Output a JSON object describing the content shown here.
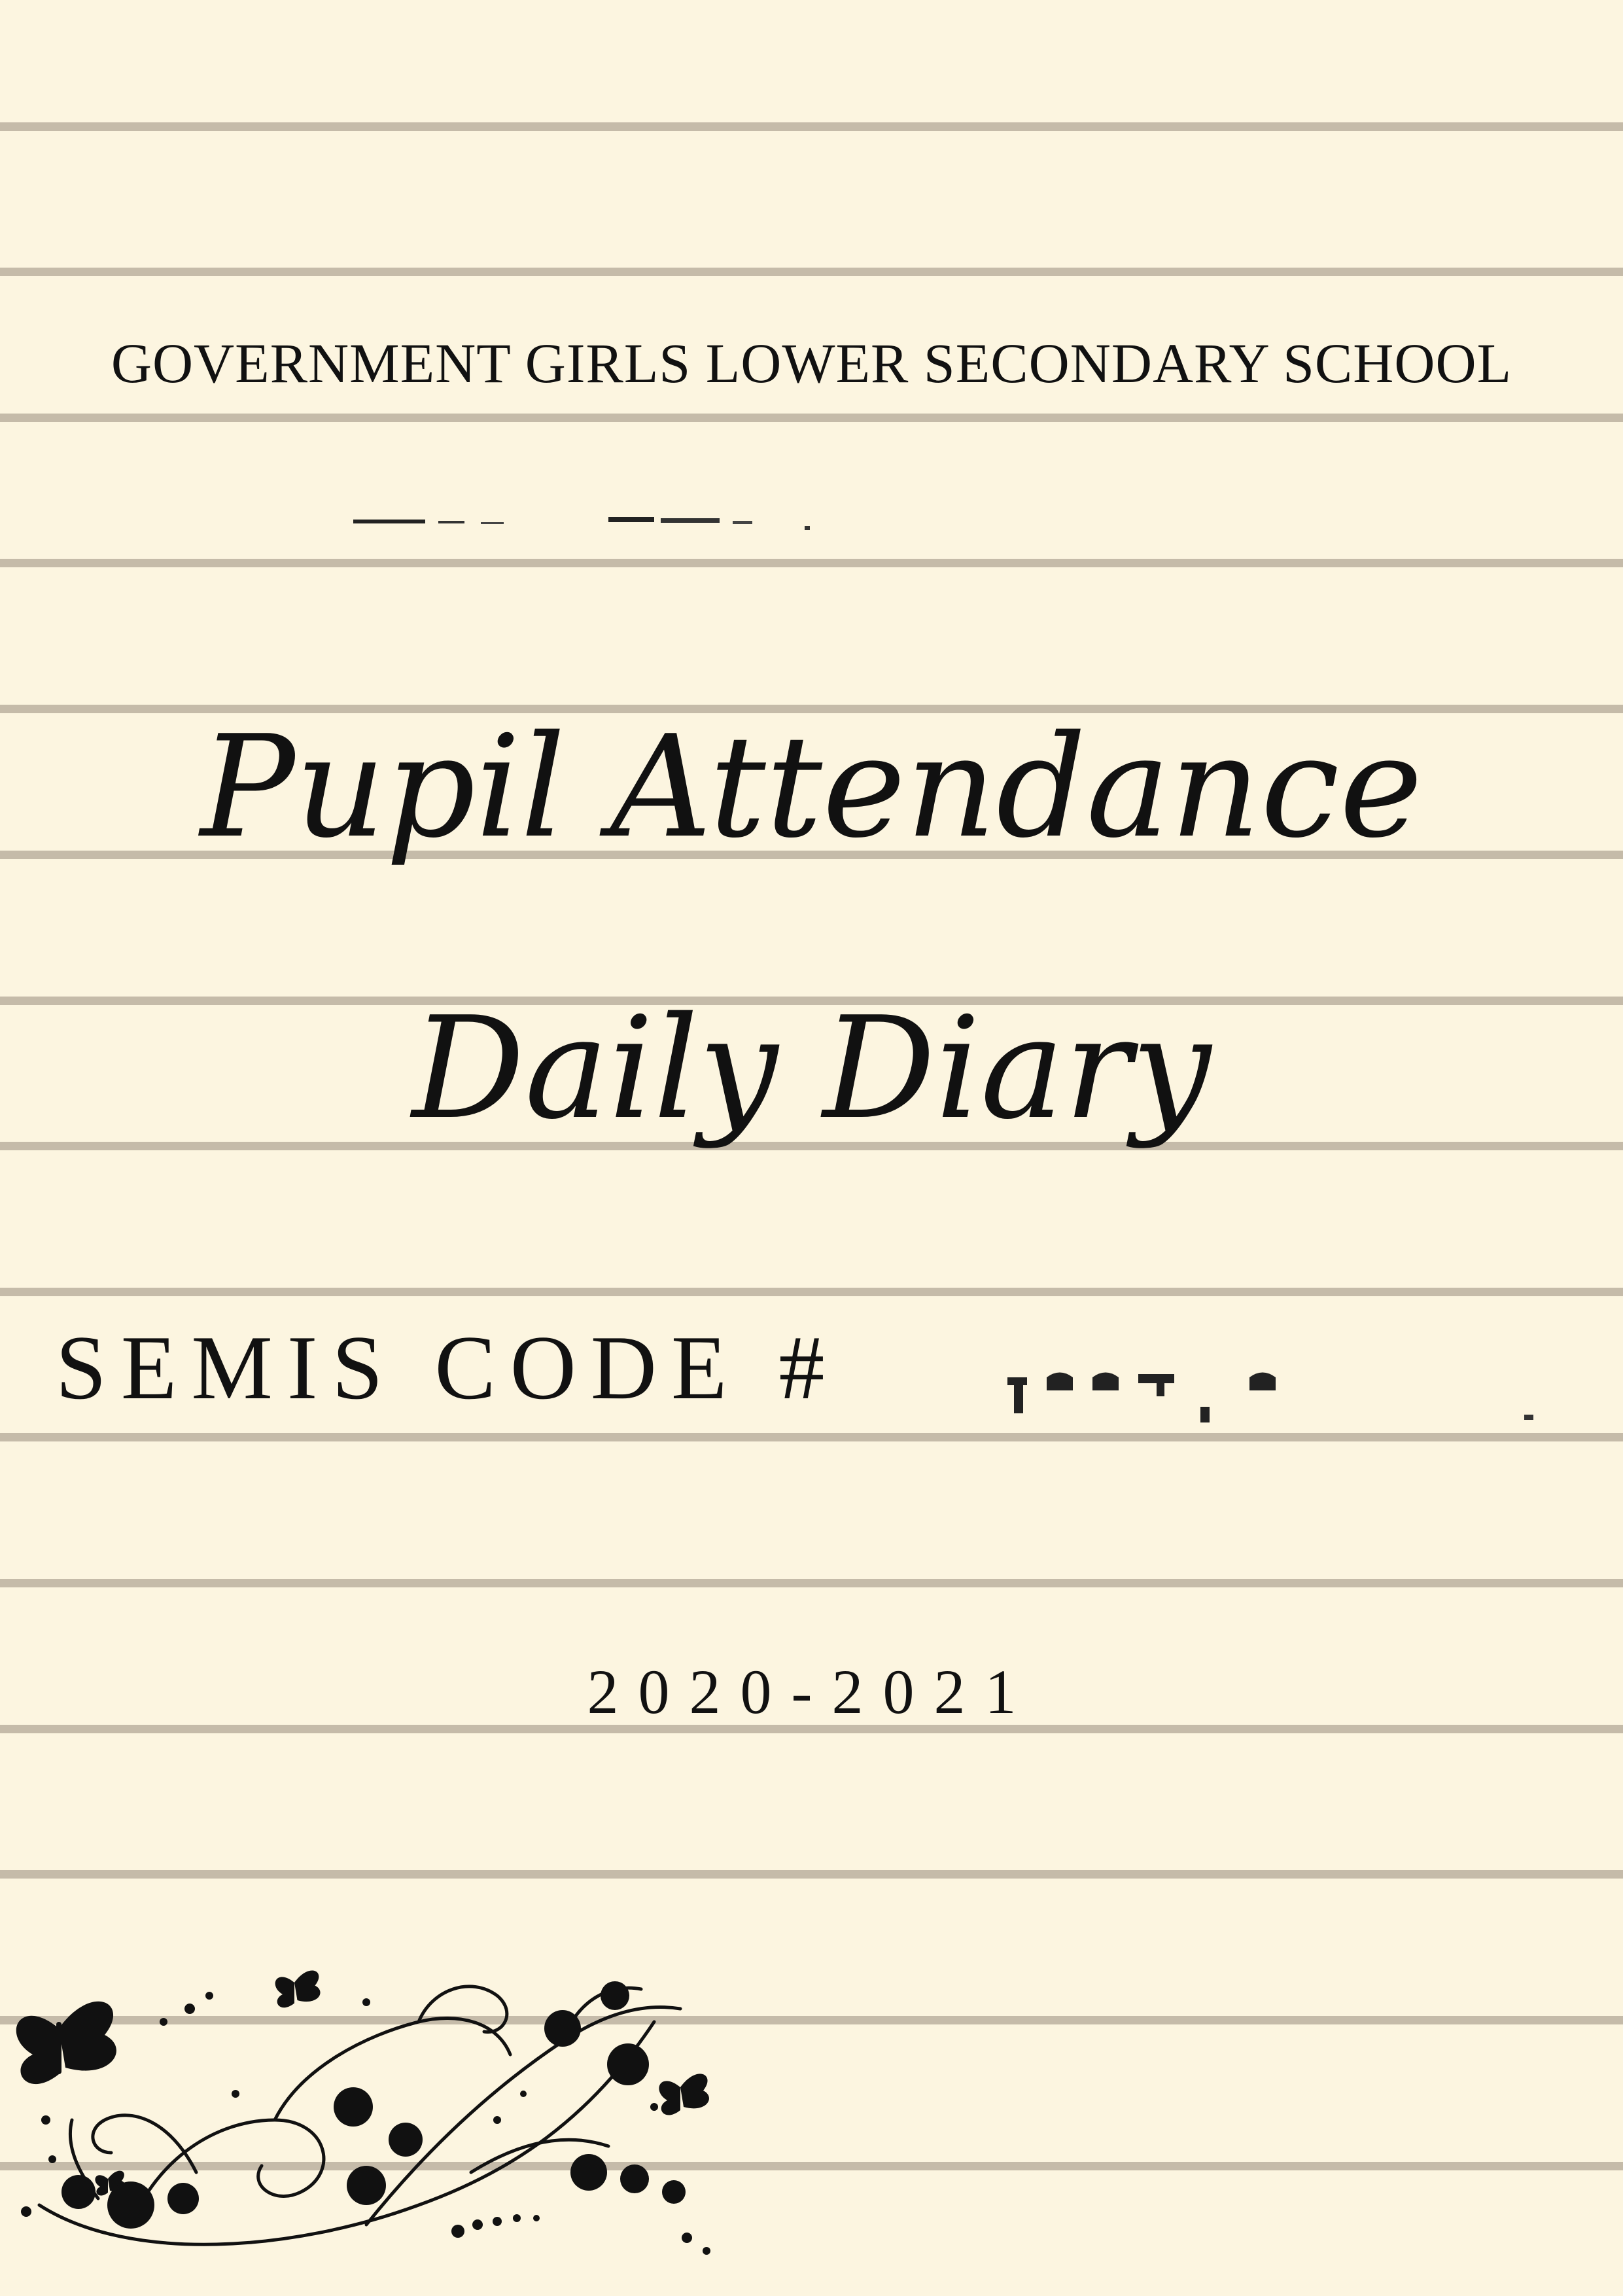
{
  "page": {
    "background_color": "#fcf5e0",
    "rule_color": "#c5bba9"
  },
  "cover": {
    "school_name": "GOVERNMENT GIRLS LOWER SECONDARY SCHOOL",
    "title_line_1": "Pupil Attendance",
    "title_line_2": "Daily Diary",
    "semis_label": "SEMIS CODE #",
    "academic_year": "2020-2021"
  },
  "decoration": {
    "ornament_icon": "floral-vine-with-butterflies-icon"
  }
}
